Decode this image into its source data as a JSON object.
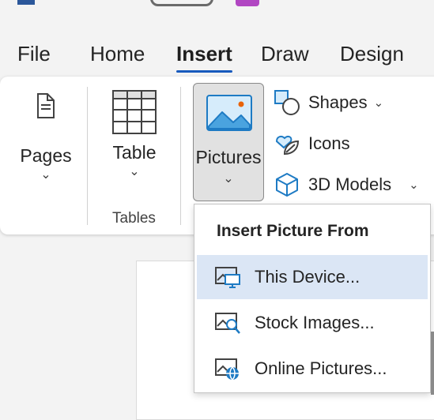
{
  "tabs": [
    {
      "label": "File"
    },
    {
      "label": "Home"
    },
    {
      "label": "Insert",
      "active": true
    },
    {
      "label": "Draw"
    },
    {
      "label": "Design"
    }
  ],
  "ribbon": {
    "pages": {
      "label": "Pages",
      "icon": "pages-icon"
    },
    "table": {
      "label": "Table",
      "icon": "table-icon"
    },
    "tables_group_label": "Tables",
    "pictures": {
      "label": "Pictures",
      "icon": "pictures-icon",
      "pressed": true
    },
    "shapes": {
      "label": "Shapes",
      "icon": "shapes-icon"
    },
    "icons": {
      "label": "Icons",
      "icon": "icons-icon"
    },
    "models": {
      "label": "3D Models",
      "icon": "cube-icon"
    }
  },
  "dropdown": {
    "title": "Insert Picture From",
    "items": [
      {
        "label": "This Device...",
        "icon": "device-picture-icon",
        "highlighted": true
      },
      {
        "label": "Stock Images...",
        "icon": "stock-images-icon"
      },
      {
        "label": "Online Pictures...",
        "icon": "online-pictures-icon"
      }
    ]
  },
  "colors": {
    "accent": "#185abd",
    "icon_blue": "#1e7bc4",
    "pressed_bg": "#e1e1e1",
    "hover_bg": "#dbe6f5"
  }
}
